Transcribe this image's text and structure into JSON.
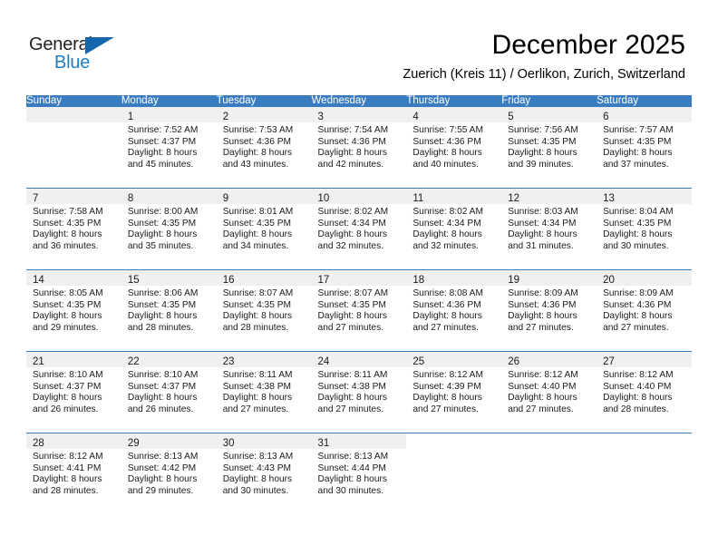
{
  "logo": {
    "word_one": "General",
    "word_two": "Blue",
    "triangle_icon": "triangle-icon",
    "colors": {
      "dark": "#231f20",
      "blue": "#1f7dc4",
      "triangle": "#1566ad"
    }
  },
  "header": {
    "title": "December 2025",
    "subtitle": "Zuerich (Kreis 11) / Oerlikon, Zurich, Switzerland",
    "accent_color": "#3a7cc0"
  },
  "weekdays": [
    "Sunday",
    "Monday",
    "Tuesday",
    "Wednesday",
    "Thursday",
    "Friday",
    "Saturday"
  ],
  "labels": {
    "sunrise": "Sunrise:",
    "sunset": "Sunset:",
    "daylight": "Daylight:"
  },
  "weeks": [
    [
      {
        "day": "",
        "sunrise": "",
        "sunset": "",
        "daylight_line1": "",
        "daylight_line2": ""
      },
      {
        "day": "1",
        "sunrise": "Sunrise: 7:52 AM",
        "sunset": "Sunset: 4:37 PM",
        "daylight_line1": "Daylight: 8 hours",
        "daylight_line2": "and 45 minutes."
      },
      {
        "day": "2",
        "sunrise": "Sunrise: 7:53 AM",
        "sunset": "Sunset: 4:36 PM",
        "daylight_line1": "Daylight: 8 hours",
        "daylight_line2": "and 43 minutes."
      },
      {
        "day": "3",
        "sunrise": "Sunrise: 7:54 AM",
        "sunset": "Sunset: 4:36 PM",
        "daylight_line1": "Daylight: 8 hours",
        "daylight_line2": "and 42 minutes."
      },
      {
        "day": "4",
        "sunrise": "Sunrise: 7:55 AM",
        "sunset": "Sunset: 4:36 PM",
        "daylight_line1": "Daylight: 8 hours",
        "daylight_line2": "and 40 minutes."
      },
      {
        "day": "5",
        "sunrise": "Sunrise: 7:56 AM",
        "sunset": "Sunset: 4:35 PM",
        "daylight_line1": "Daylight: 8 hours",
        "daylight_line2": "and 39 minutes."
      },
      {
        "day": "6",
        "sunrise": "Sunrise: 7:57 AM",
        "sunset": "Sunset: 4:35 PM",
        "daylight_line1": "Daylight: 8 hours",
        "daylight_line2": "and 37 minutes."
      }
    ],
    [
      {
        "day": "7",
        "sunrise": "Sunrise: 7:58 AM",
        "sunset": "Sunset: 4:35 PM",
        "daylight_line1": "Daylight: 8 hours",
        "daylight_line2": "and 36 minutes."
      },
      {
        "day": "8",
        "sunrise": "Sunrise: 8:00 AM",
        "sunset": "Sunset: 4:35 PM",
        "daylight_line1": "Daylight: 8 hours",
        "daylight_line2": "and 35 minutes."
      },
      {
        "day": "9",
        "sunrise": "Sunrise: 8:01 AM",
        "sunset": "Sunset: 4:35 PM",
        "daylight_line1": "Daylight: 8 hours",
        "daylight_line2": "and 34 minutes."
      },
      {
        "day": "10",
        "sunrise": "Sunrise: 8:02 AM",
        "sunset": "Sunset: 4:34 PM",
        "daylight_line1": "Daylight: 8 hours",
        "daylight_line2": "and 32 minutes."
      },
      {
        "day": "11",
        "sunrise": "Sunrise: 8:02 AM",
        "sunset": "Sunset: 4:34 PM",
        "daylight_line1": "Daylight: 8 hours",
        "daylight_line2": "and 32 minutes."
      },
      {
        "day": "12",
        "sunrise": "Sunrise: 8:03 AM",
        "sunset": "Sunset: 4:34 PM",
        "daylight_line1": "Daylight: 8 hours",
        "daylight_line2": "and 31 minutes."
      },
      {
        "day": "13",
        "sunrise": "Sunrise: 8:04 AM",
        "sunset": "Sunset: 4:35 PM",
        "daylight_line1": "Daylight: 8 hours",
        "daylight_line2": "and 30 minutes."
      }
    ],
    [
      {
        "day": "14",
        "sunrise": "Sunrise: 8:05 AM",
        "sunset": "Sunset: 4:35 PM",
        "daylight_line1": "Daylight: 8 hours",
        "daylight_line2": "and 29 minutes."
      },
      {
        "day": "15",
        "sunrise": "Sunrise: 8:06 AM",
        "sunset": "Sunset: 4:35 PM",
        "daylight_line1": "Daylight: 8 hours",
        "daylight_line2": "and 28 minutes."
      },
      {
        "day": "16",
        "sunrise": "Sunrise: 8:07 AM",
        "sunset": "Sunset: 4:35 PM",
        "daylight_line1": "Daylight: 8 hours",
        "daylight_line2": "and 28 minutes."
      },
      {
        "day": "17",
        "sunrise": "Sunrise: 8:07 AM",
        "sunset": "Sunset: 4:35 PM",
        "daylight_line1": "Daylight: 8 hours",
        "daylight_line2": "and 27 minutes."
      },
      {
        "day": "18",
        "sunrise": "Sunrise: 8:08 AM",
        "sunset": "Sunset: 4:36 PM",
        "daylight_line1": "Daylight: 8 hours",
        "daylight_line2": "and 27 minutes."
      },
      {
        "day": "19",
        "sunrise": "Sunrise: 8:09 AM",
        "sunset": "Sunset: 4:36 PM",
        "daylight_line1": "Daylight: 8 hours",
        "daylight_line2": "and 27 minutes."
      },
      {
        "day": "20",
        "sunrise": "Sunrise: 8:09 AM",
        "sunset": "Sunset: 4:36 PM",
        "daylight_line1": "Daylight: 8 hours",
        "daylight_line2": "and 27 minutes."
      }
    ],
    [
      {
        "day": "21",
        "sunrise": "Sunrise: 8:10 AM",
        "sunset": "Sunset: 4:37 PM",
        "daylight_line1": "Daylight: 8 hours",
        "daylight_line2": "and 26 minutes."
      },
      {
        "day": "22",
        "sunrise": "Sunrise: 8:10 AM",
        "sunset": "Sunset: 4:37 PM",
        "daylight_line1": "Daylight: 8 hours",
        "daylight_line2": "and 26 minutes."
      },
      {
        "day": "23",
        "sunrise": "Sunrise: 8:11 AM",
        "sunset": "Sunset: 4:38 PM",
        "daylight_line1": "Daylight: 8 hours",
        "daylight_line2": "and 27 minutes."
      },
      {
        "day": "24",
        "sunrise": "Sunrise: 8:11 AM",
        "sunset": "Sunset: 4:38 PM",
        "daylight_line1": "Daylight: 8 hours",
        "daylight_line2": "and 27 minutes."
      },
      {
        "day": "25",
        "sunrise": "Sunrise: 8:12 AM",
        "sunset": "Sunset: 4:39 PM",
        "daylight_line1": "Daylight: 8 hours",
        "daylight_line2": "and 27 minutes."
      },
      {
        "day": "26",
        "sunrise": "Sunrise: 8:12 AM",
        "sunset": "Sunset: 4:40 PM",
        "daylight_line1": "Daylight: 8 hours",
        "daylight_line2": "and 27 minutes."
      },
      {
        "day": "27",
        "sunrise": "Sunrise: 8:12 AM",
        "sunset": "Sunset: 4:40 PM",
        "daylight_line1": "Daylight: 8 hours",
        "daylight_line2": "and 28 minutes."
      }
    ],
    [
      {
        "day": "28",
        "sunrise": "Sunrise: 8:12 AM",
        "sunset": "Sunset: 4:41 PM",
        "daylight_line1": "Daylight: 8 hours",
        "daylight_line2": "and 28 minutes."
      },
      {
        "day": "29",
        "sunrise": "Sunrise: 8:13 AM",
        "sunset": "Sunset: 4:42 PM",
        "daylight_line1": "Daylight: 8 hours",
        "daylight_line2": "and 29 minutes."
      },
      {
        "day": "30",
        "sunrise": "Sunrise: 8:13 AM",
        "sunset": "Sunset: 4:43 PM",
        "daylight_line1": "Daylight: 8 hours",
        "daylight_line2": "and 30 minutes."
      },
      {
        "day": "31",
        "sunrise": "Sunrise: 8:13 AM",
        "sunset": "Sunset: 4:44 PM",
        "daylight_line1": "Daylight: 8 hours",
        "daylight_line2": "and 30 minutes."
      },
      {
        "day": "",
        "sunrise": "",
        "sunset": "",
        "daylight_line1": "",
        "daylight_line2": ""
      },
      {
        "day": "",
        "sunrise": "",
        "sunset": "",
        "daylight_line1": "",
        "daylight_line2": ""
      },
      {
        "day": "",
        "sunrise": "",
        "sunset": "",
        "daylight_line1": "",
        "daylight_line2": ""
      }
    ]
  ]
}
